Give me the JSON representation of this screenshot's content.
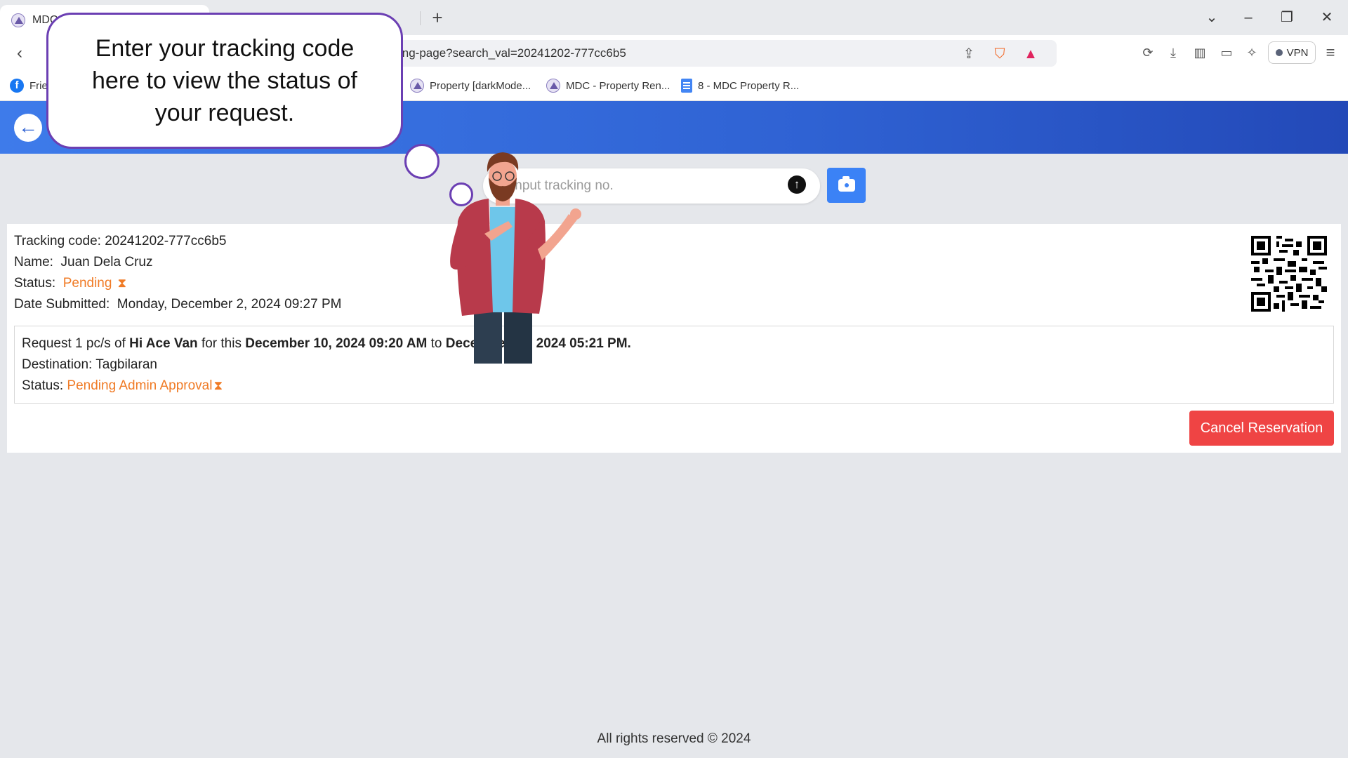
{
  "browser": {
    "active_tab_title": "MDC",
    "url": "cking-page?search_val=20241202-777cc6b5",
    "vpn_label": "VPN",
    "bookmarks": [
      {
        "label": "Frie",
        "icon": "facebook-icon"
      },
      {
        "label": "Property [darkMode...",
        "icon": "mdc-logo-icon"
      },
      {
        "label": "MDC - Property Ren...",
        "icon": "mdc-logo-icon"
      },
      {
        "label": "8 - MDC Property R...",
        "icon": "google-docs-icon"
      }
    ]
  },
  "tutorial": {
    "bubble_text": "Enter your tracking code here to view the status of your request."
  },
  "search": {
    "placeholder": "Input tracking no."
  },
  "tracking": {
    "code_label": "Tracking code: ",
    "code_value": "20241202-777cc6b5",
    "name_label": "Name:  ",
    "name_value": "Juan Dela Cruz",
    "status_label": "Status:  ",
    "status_value": "Pending",
    "date_label": "Date Submitted:  ",
    "date_value": "Monday, December 2, 2024 09:27 PM"
  },
  "request": {
    "prefix": "Request 1 pc/s of ",
    "item": "Hi Ace Van",
    "for_this": " for this ",
    "start": "December 10, 2024 09:20 AM",
    "to": " to ",
    "end": "December 10, 2024 05:21 PM.",
    "destination_label": "Destination: ",
    "destination_value": "Tagbilaran",
    "status_label": "Status: ",
    "status_value": "Pending Admin Approval"
  },
  "actions": {
    "cancel_label": "Cancel Reservation"
  },
  "footer": {
    "text": "All rights reserved © 2024"
  },
  "colors": {
    "accent_blue": "#2f62d3",
    "pending_orange": "#f07b26",
    "cancel_red": "#ef4444",
    "tutorial_purple": "#6b3fb3"
  }
}
